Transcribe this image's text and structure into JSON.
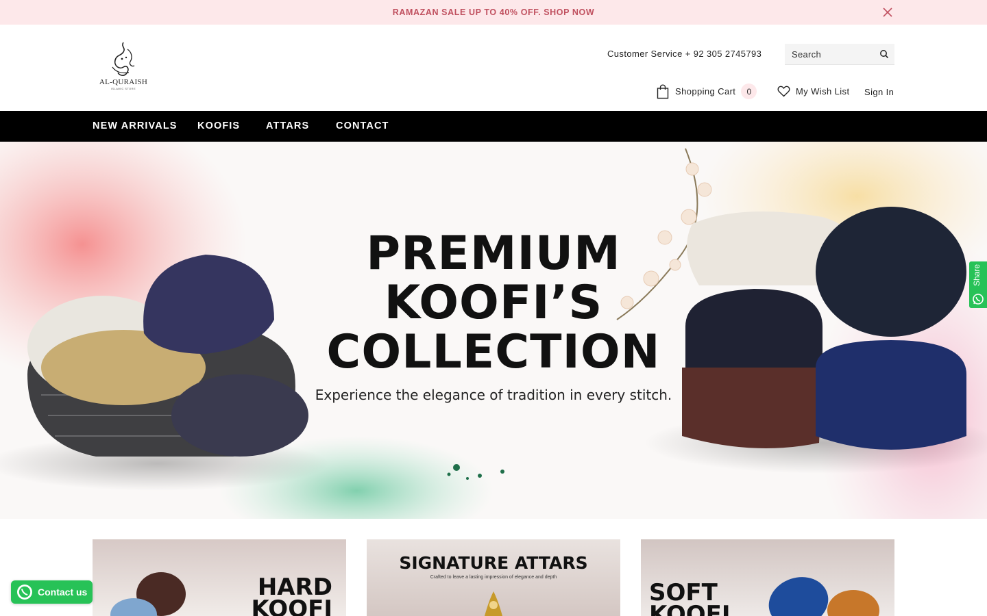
{
  "announcement": {
    "text": "RAMAZAN SALE UP TO 40% OFF. SHOP NOW"
  },
  "brand": {
    "name": "AL-QURAISH",
    "tagline": "ISLAMIC STORE",
    "logo_icon": "calligraphy-logo-icon"
  },
  "header": {
    "customer_service": "Customer Service + 92 305 2745793",
    "search_placeholder": "Search",
    "cart_label": "Shopping Cart",
    "cart_count": "0",
    "wishlist_label": "My Wish List",
    "signin_label": "Sign In"
  },
  "nav": {
    "items": [
      {
        "label": "NEW ARRIVALS"
      },
      {
        "label": "KOOFIS"
      },
      {
        "label": "ATTARS"
      },
      {
        "label": "CONTACT"
      }
    ]
  },
  "hero": {
    "title_line1": "PREMIUM",
    "title_line2": "KOOFI’S",
    "title_line3": "COLLECTION",
    "subtitle": "Experience the elegance of tradition in every stitch."
  },
  "share": {
    "label": "Share",
    "icon": "whatsapp-icon"
  },
  "categories": [
    {
      "title_line1": "HARD",
      "title_line2": "KOOFI"
    },
    {
      "title": "SIGNATURE ATTARS",
      "subtitle": "Crafted to leave a lasting impression of elegance and depth"
    },
    {
      "title_line1": "SOFT",
      "title_line2": "KOOFI"
    }
  ],
  "contact_button": {
    "label": "Contact us",
    "icon": "whatsapp-icon"
  },
  "colors": {
    "announce_bg": "#fde8ea",
    "announce_text": "#c0505f",
    "nav_bg": "#000000",
    "whatsapp": "#27c257"
  }
}
